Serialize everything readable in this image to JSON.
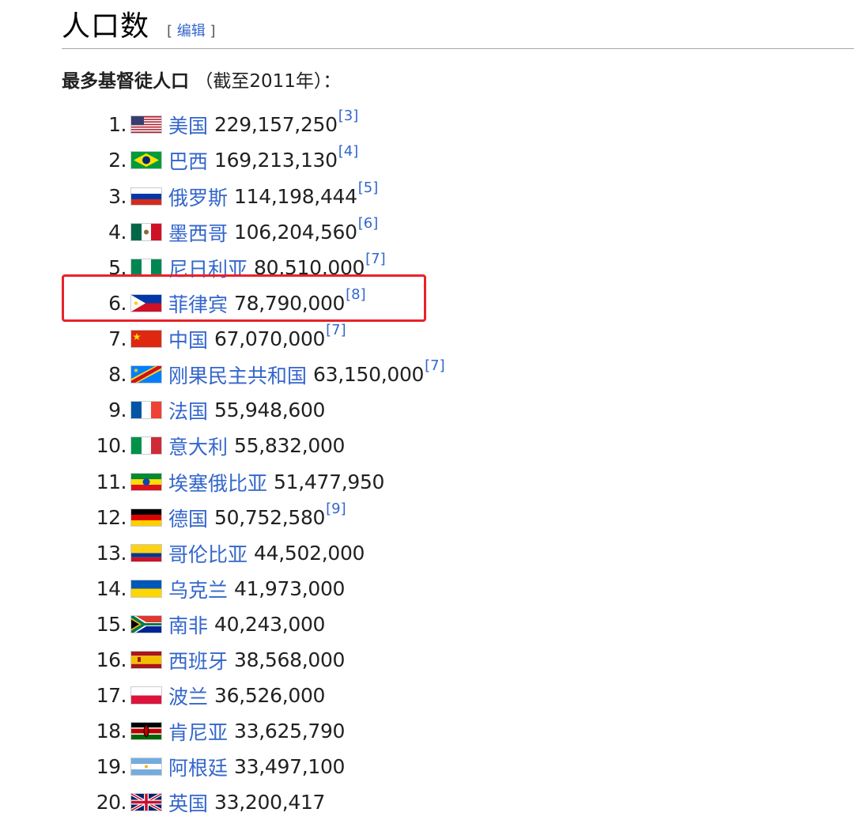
{
  "heading": {
    "title": "人口数",
    "edit_open": "[",
    "edit_label": "编辑",
    "edit_close": "]"
  },
  "intro": {
    "bold": "最多基督徒人口",
    "rest": "（截至2011年）："
  },
  "rows": [
    {
      "n": "1.",
      "country": "美国",
      "pop": "229,157,250",
      "ref": "[3]",
      "flag": "us-flag-icon"
    },
    {
      "n": "2.",
      "country": "巴西",
      "pop": "169,213,130",
      "ref": "[4]",
      "flag": "brazil-flag-icon"
    },
    {
      "n": "3.",
      "country": "俄罗斯",
      "pop": "114,198,444",
      "ref": "[5]",
      "flag": "russia-flag-icon"
    },
    {
      "n": "4.",
      "country": "墨西哥",
      "pop": "106,204,560",
      "ref": "[6]",
      "flag": "mexico-flag-icon"
    },
    {
      "n": "5.",
      "country": "尼日利亚",
      "pop": "80,510,000",
      "ref": "[7]",
      "flag": "nigeria-flag-icon"
    },
    {
      "n": "6.",
      "country": "菲律宾",
      "pop": "78,790,000",
      "ref": "[8]",
      "flag": "philippines-flag-icon"
    },
    {
      "n": "7.",
      "country": "中国",
      "pop": "67,070,000",
      "ref": "[7]",
      "flag": "china-flag-icon"
    },
    {
      "n": "8.",
      "country": "刚果民主共和国",
      "pop": "63,150,000",
      "ref": "[7]",
      "flag": "drc-flag-icon"
    },
    {
      "n": "9.",
      "country": "法国",
      "pop": "55,948,600",
      "ref": "",
      "flag": "france-flag-icon"
    },
    {
      "n": "10.",
      "country": "意大利",
      "pop": "55,832,000",
      "ref": "",
      "flag": "italy-flag-icon"
    },
    {
      "n": "11.",
      "country": "埃塞俄比亚",
      "pop": "51,477,950",
      "ref": "",
      "flag": "ethiopia-flag-icon"
    },
    {
      "n": "12.",
      "country": "德国",
      "pop": "50,752,580",
      "ref": "[9]",
      "flag": "germany-flag-icon"
    },
    {
      "n": "13.",
      "country": "哥伦比亚",
      "pop": "44,502,000",
      "ref": "",
      "flag": "colombia-flag-icon"
    },
    {
      "n": "14.",
      "country": "乌克兰",
      "pop": "41,973,000",
      "ref": "",
      "flag": "ukraine-flag-icon"
    },
    {
      "n": "15.",
      "country": "南非",
      "pop": "40,243,000",
      "ref": "",
      "flag": "south-africa-flag-icon"
    },
    {
      "n": "16.",
      "country": "西班牙",
      "pop": "38,568,000",
      "ref": "",
      "flag": "spain-flag-icon"
    },
    {
      "n": "17.",
      "country": "波兰",
      "pop": "36,526,000",
      "ref": "",
      "flag": "poland-flag-icon"
    },
    {
      "n": "18.",
      "country": "肯尼亚",
      "pop": "33,625,790",
      "ref": "",
      "flag": "kenya-flag-icon"
    },
    {
      "n": "19.",
      "country": "阿根廷",
      "pop": "33,497,100",
      "ref": "",
      "flag": "argentina-flag-icon"
    },
    {
      "n": "20.",
      "country": "英国",
      "pop": "33,200,417",
      "ref": "",
      "flag": "uk-flag-icon"
    }
  ],
  "colors": {
    "link": "#3366cc",
    "highlight_border": "#e8232a",
    "rule": "#a2a9b1"
  }
}
